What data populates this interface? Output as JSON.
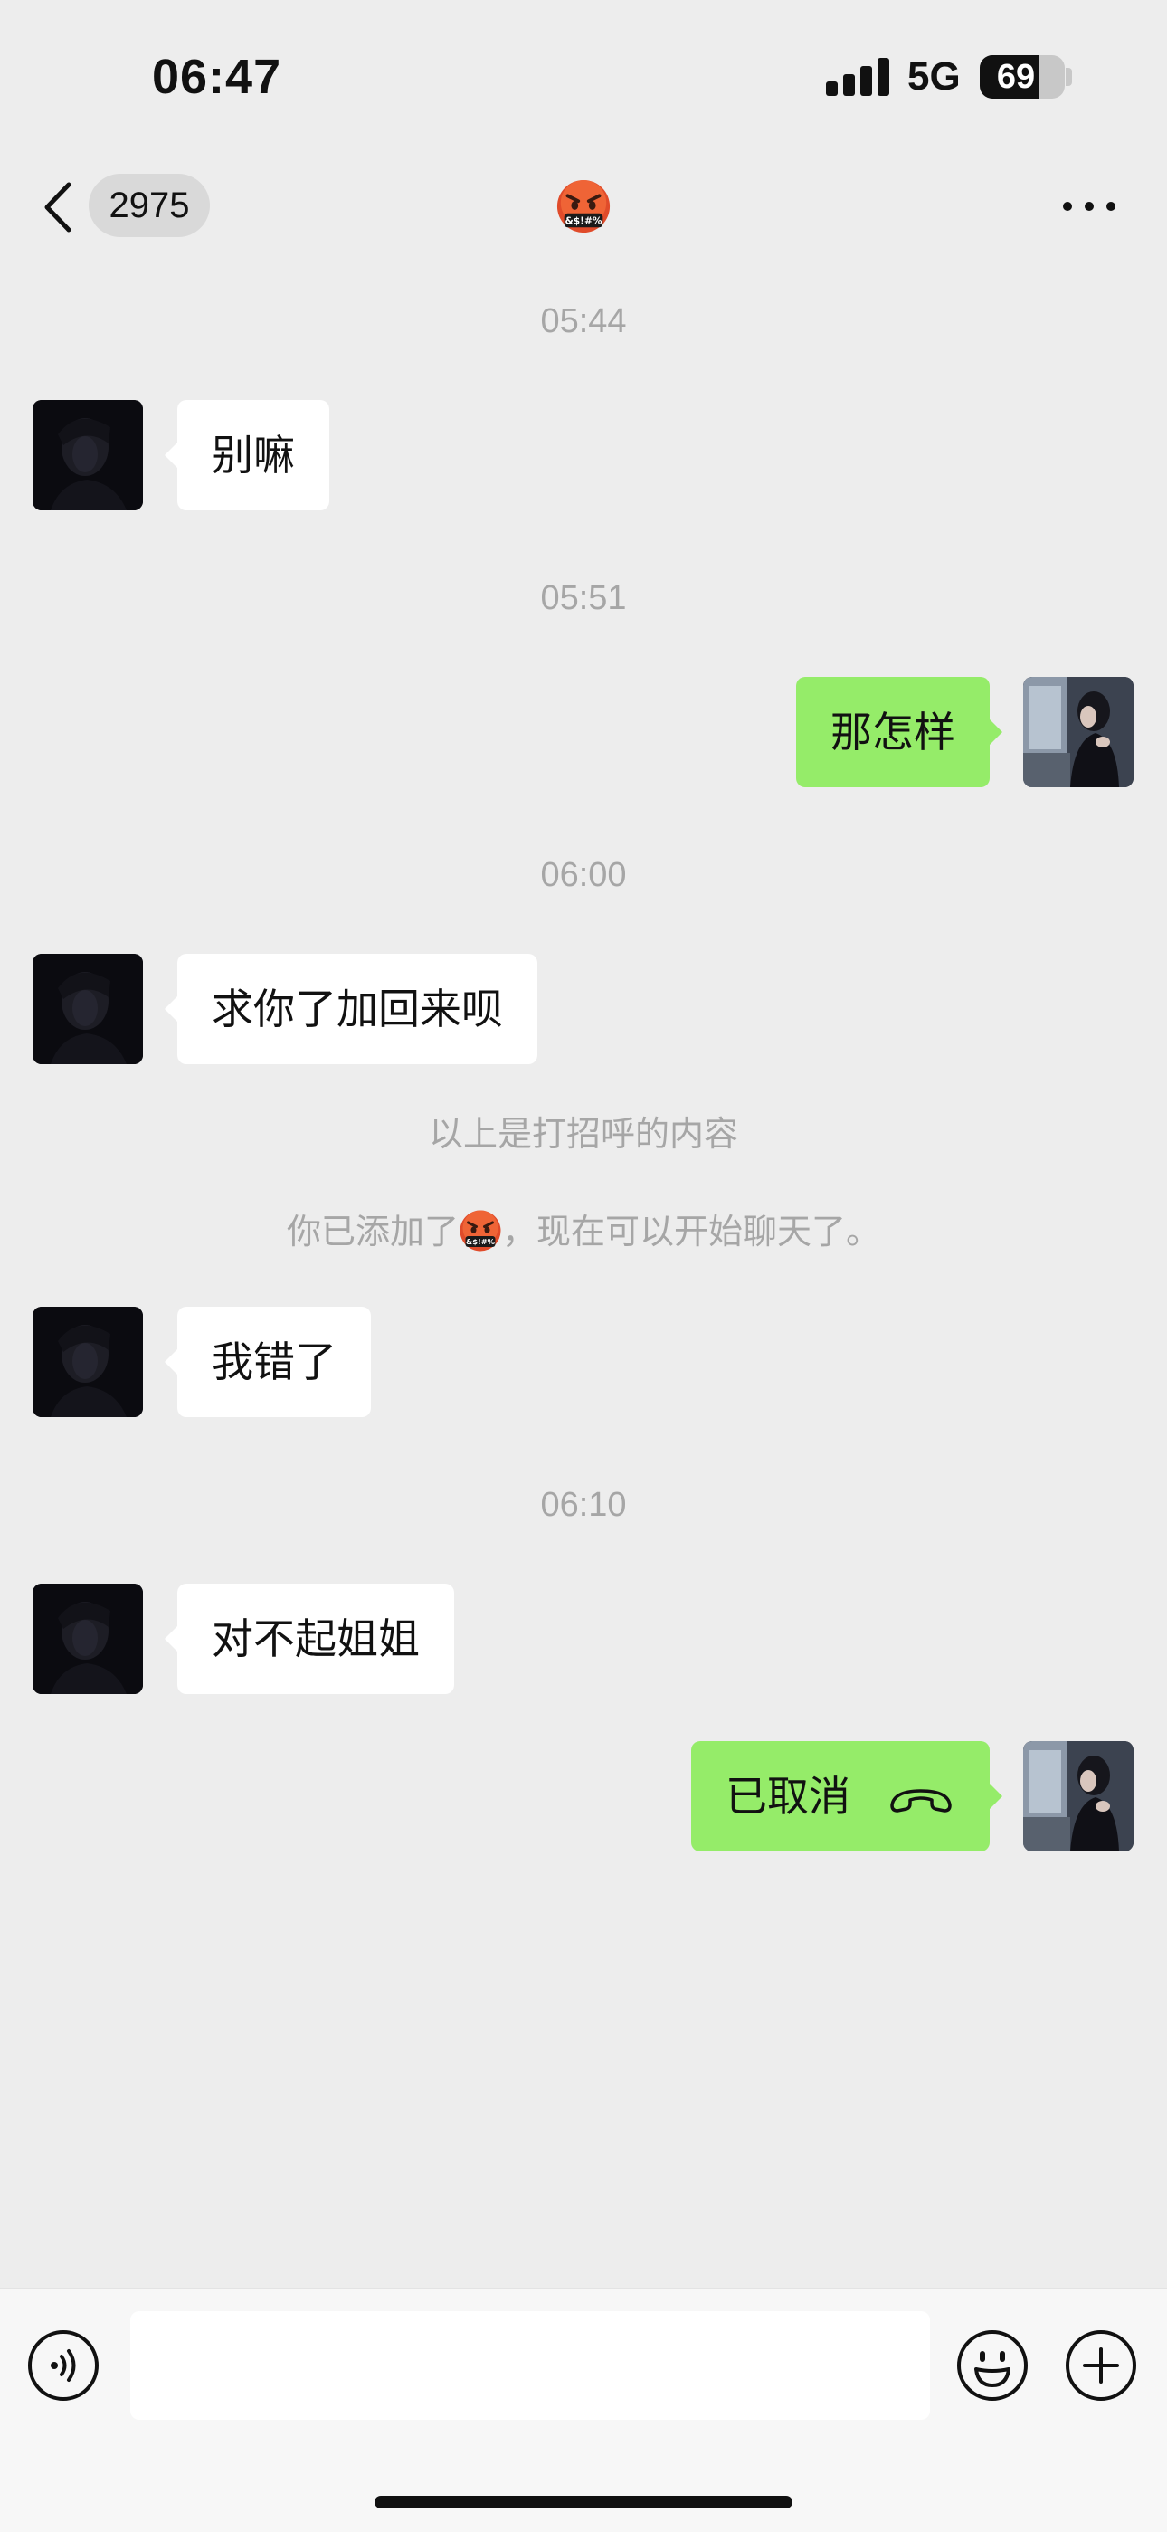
{
  "status_bar": {
    "time": "06:47",
    "network": "5G",
    "battery": "69",
    "battery_level": 0.69
  },
  "nav": {
    "unread_count": "2975",
    "title_icon": "angry-cursing-emoji",
    "more_icon": "ellipsis-icon"
  },
  "messages": [
    {
      "type": "time",
      "text": "05:44"
    },
    {
      "type": "in",
      "text": "别嘛"
    },
    {
      "type": "time",
      "text": "05:51"
    },
    {
      "type": "out",
      "text": "那怎样"
    },
    {
      "type": "time",
      "text": "06:00"
    },
    {
      "type": "in",
      "text": "求你了加回来呗"
    },
    {
      "type": "system",
      "text": "以上是打招呼的内容"
    },
    {
      "type": "system",
      "text_before": "你已添加了",
      "text_after": "，现在可以开始聊天了。"
    },
    {
      "type": "in",
      "text": "我错了"
    },
    {
      "type": "time",
      "text": "06:10"
    },
    {
      "type": "in",
      "text": "对不起姐姐"
    },
    {
      "type": "out",
      "text": "已取消",
      "icon": "hang-up-icon"
    }
  ],
  "input_bar": {
    "voice_icon": "voice-icon",
    "emoji_icon": "emoji-icon",
    "plus_icon": "plus-icon",
    "text_value": ""
  },
  "colors": {
    "background": "#ededed",
    "outgoing_bubble": "#95ec69",
    "incoming_bubble": "#ffffff",
    "timestamp": "#a6a6a6"
  }
}
